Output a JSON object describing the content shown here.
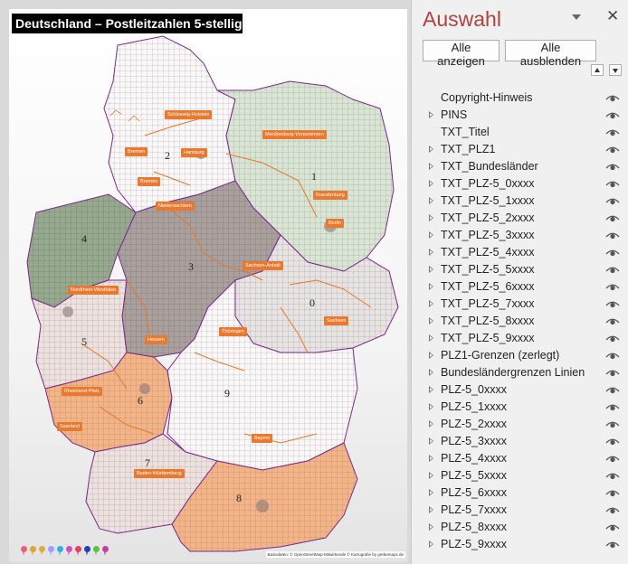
{
  "slide": {
    "title": "Deutschland – Postleitzahlen 5-stellig",
    "copyright": "Basisdaten: © OpenStreetMap-Mitwirkende  © Kartografie by grebemaps.de",
    "state_labels": [
      "Schleswig-Holstein",
      "Mecklenburg-Vorpommern",
      "Hamburg",
      "Bremen",
      "Bremen",
      "Niedersachsen",
      "Brandenburg",
      "Berlin",
      "Sachsen-Anhalt",
      "Nordrhein-Westfalen",
      "Thüringen",
      "Sachsen",
      "Hessen",
      "Rheinland-Pfalz",
      "Saarland",
      "Bayern",
      "Baden-Württemberg"
    ],
    "zone_digits": [
      "0",
      "1",
      "2",
      "3",
      "4",
      "5",
      "6",
      "7",
      "8",
      "9"
    ],
    "pin_colors": [
      "#e8607a",
      "#e8a040",
      "#d4b040",
      "#9aa0ff",
      "#30b0e0",
      "#d050c0",
      "#e84060",
      "#2040c0",
      "#60c040",
      "#c040a0"
    ]
  },
  "pane": {
    "title": "Auswahl",
    "close_symbol": "✕",
    "show_all": "Alle anzeigen",
    "hide_all": "Alle ausblenden",
    "layers": [
      {
        "label": "Copyright-Hinweis",
        "expandable": false
      },
      {
        "label": "PINS",
        "expandable": true
      },
      {
        "label": "TXT_Titel",
        "expandable": false
      },
      {
        "label": "TXT_PLZ1",
        "expandable": true
      },
      {
        "label": "TXT_Bundesländer",
        "expandable": true
      },
      {
        "label": "TXT_PLZ-5_0xxxx",
        "expandable": true
      },
      {
        "label": "TXT_PLZ-5_1xxxx",
        "expandable": true
      },
      {
        "label": "TXT_PLZ-5_2xxxx",
        "expandable": true
      },
      {
        "label": "TXT_PLZ-5_3xxxx",
        "expandable": true
      },
      {
        "label": "TXT_PLZ-5_4xxxx",
        "expandable": true
      },
      {
        "label": "TXT_PLZ-5_5xxxx",
        "expandable": true
      },
      {
        "label": "TXT_PLZ-5_6xxxx",
        "expandable": true
      },
      {
        "label": "TXT_PLZ-5_7xxxx",
        "expandable": true
      },
      {
        "label": "TXT_PLZ-5_8xxxx",
        "expandable": true
      },
      {
        "label": "TXT_PLZ-5_9xxxx",
        "expandable": true
      },
      {
        "label": "PLZ1-Grenzen (zerlegt)",
        "expandable": true
      },
      {
        "label": "Bundesländergrenzen Linien",
        "expandable": true
      },
      {
        "label": "PLZ-5_0xxxx",
        "expandable": true
      },
      {
        "label": "PLZ-5_1xxxx",
        "expandable": true
      },
      {
        "label": "PLZ-5_2xxxx",
        "expandable": true
      },
      {
        "label": "PLZ-5_3xxxx",
        "expandable": true
      },
      {
        "label": "PLZ-5_4xxxx",
        "expandable": true
      },
      {
        "label": "PLZ-5_5xxxx",
        "expandable": true
      },
      {
        "label": "PLZ-5_6xxxx",
        "expandable": true
      },
      {
        "label": "PLZ-5_7xxxx",
        "expandable": true
      },
      {
        "label": "PLZ-5_8xxxx",
        "expandable": true
      },
      {
        "label": "PLZ-5_9xxxx",
        "expandable": true
      }
    ]
  }
}
